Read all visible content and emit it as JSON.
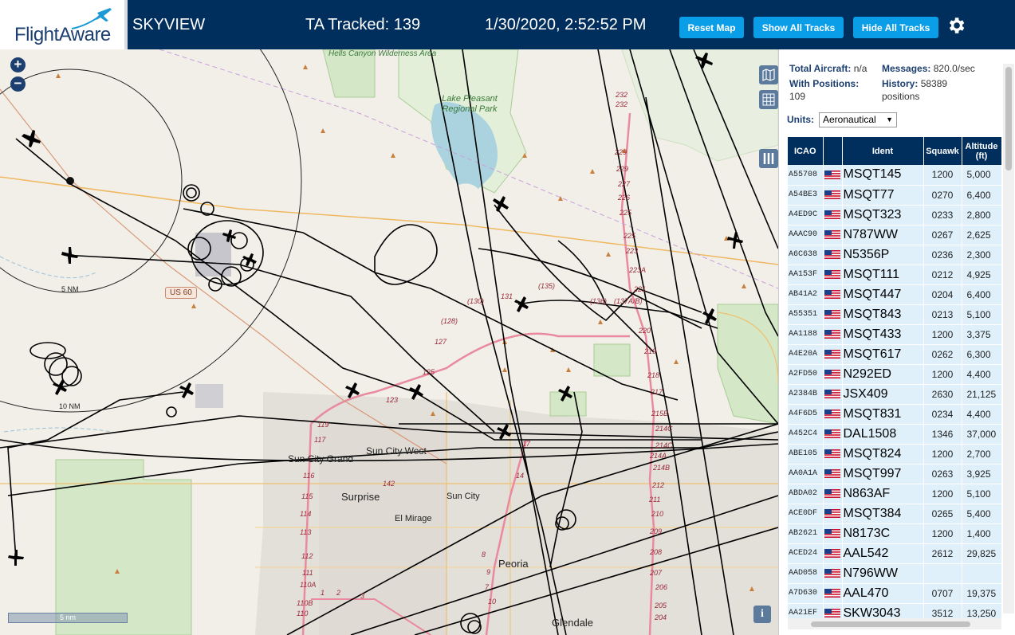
{
  "header": {
    "logo_text": "FlightAware",
    "site_name": "SKYVIEW",
    "ta_tracked": "TA Tracked: 139",
    "datetime": "1/30/2020, 2:52:52 PM",
    "buttons": {
      "reset_map": "Reset Map",
      "show_all_tracks": "Show All Tracks",
      "hide_all_tracks": "Hide All Tracks"
    },
    "settings_icon": "gear-icon",
    "colors": {
      "bar": "#002f5d",
      "button": "#0a9ee8"
    }
  },
  "map": {
    "zoom_in": "+",
    "zoom_out": "−",
    "range_labels": [
      "5 NM",
      "10 NM"
    ],
    "scale_label": "5 nm",
    "info_label": "i",
    "places": {
      "hells_canyon": "Hells Canyon Wilderness Area",
      "lake_pleasant": "Lake Pleasant Regional Park",
      "sun_city_grand": "Sun City Grand",
      "sun_city_west": "Sun City West",
      "surprise": "Surprise",
      "sun_city": "Sun City",
      "el_mirage": "El Mirage",
      "peoria": "Peoria",
      "glendale": "Glendale"
    },
    "route_shield": "US 60",
    "road_numbers_left": [
      "119",
      "117",
      "116",
      "115",
      "114",
      "113",
      "112",
      "111",
      "110A",
      "110B",
      "110",
      "1",
      "2",
      "3"
    ],
    "road_numbers_center": [
      "(130)",
      "131",
      "(135)",
      "(128)",
      "127",
      "125",
      "123",
      "142",
      "17",
      "14",
      "9",
      "8",
      "7",
      "10"
    ],
    "road_numbers_right": [
      "232",
      "232",
      "229",
      "229",
      "227",
      "226",
      "225",
      "225",
      "223",
      "223A",
      "221",
      "220",
      "219",
      "218",
      "217",
      "215B",
      "214C",
      "214C",
      "214A",
      "214B",
      "212",
      "211",
      "210",
      "209",
      "208",
      "207",
      "206",
      "205",
      "204",
      "(136)",
      "(137A/B)"
    ]
  },
  "sidebar": {
    "total_aircraft_label": "Total Aircraft:",
    "total_aircraft_value": "n/a",
    "messages_label": "Messages:",
    "messages_value": "820.0/sec",
    "with_positions_label": "With Positions:",
    "with_positions_value": "109",
    "history_label": "History:",
    "history_value": "58389",
    "history_unit": "positions",
    "units_label": "Units:",
    "units_value": "Aeronautical",
    "table": {
      "headers": [
        "ICAO",
        "",
        "Ident",
        "Squawk",
        "Altitude (ft)"
      ],
      "rows": [
        {
          "icao": "A55708",
          "ident": "MSQT145",
          "squawk": "1200",
          "alt": "5,000"
        },
        {
          "icao": "A54BE3",
          "ident": "MSQT77",
          "squawk": "0270",
          "alt": "6,400"
        },
        {
          "icao": "A4ED9C",
          "ident": "MSQT323",
          "squawk": "0233",
          "alt": "2,800"
        },
        {
          "icao": "AAAC90",
          "ident": "N787WW",
          "squawk": "0267",
          "alt": "2,625"
        },
        {
          "icao": "A6C638",
          "ident": "N5356P",
          "squawk": "0236",
          "alt": "2,300"
        },
        {
          "icao": "AA153F",
          "ident": "MSQT111",
          "squawk": "0212",
          "alt": "4,925"
        },
        {
          "icao": "AB41A2",
          "ident": "MSQT447",
          "squawk": "0204",
          "alt": "6,400"
        },
        {
          "icao": "A55351",
          "ident": "MSQT843",
          "squawk": "0213",
          "alt": "5,100"
        },
        {
          "icao": "AA1188",
          "ident": "MSQT433",
          "squawk": "1200",
          "alt": "3,375"
        },
        {
          "icao": "A4E20A",
          "ident": "MSQT617",
          "squawk": "0262",
          "alt": "6,300"
        },
        {
          "icao": "A2FD50",
          "ident": "N292ED",
          "squawk": "1200",
          "alt": "4,400"
        },
        {
          "icao": "A2384B",
          "ident": "JSX409",
          "squawk": "2630",
          "alt": "21,125"
        },
        {
          "icao": "A4F6D5",
          "ident": "MSQT831",
          "squawk": "0234",
          "alt": "4,400"
        },
        {
          "icao": "A452C4",
          "ident": "DAL1508",
          "squawk": "1346",
          "alt": "37,000"
        },
        {
          "icao": "ABE105",
          "ident": "MSQT824",
          "squawk": "1200",
          "alt": "2,700"
        },
        {
          "icao": "AA0A1A",
          "ident": "MSQT997",
          "squawk": "0263",
          "alt": "3,925"
        },
        {
          "icao": "ABDA02",
          "ident": "N863AF",
          "squawk": "1200",
          "alt": "5,100"
        },
        {
          "icao": "ACE0DF",
          "ident": "MSQT384",
          "squawk": "0265",
          "alt": "5,400"
        },
        {
          "icao": "AB2621",
          "ident": "N8173C",
          "squawk": "1200",
          "alt": "1,400"
        },
        {
          "icao": "ACED24",
          "ident": "AAL542",
          "squawk": "2612",
          "alt": "29,825"
        },
        {
          "icao": "AAD058",
          "ident": "N796WW",
          "squawk": "",
          "alt": ""
        },
        {
          "icao": "A7D630",
          "ident": "AAL470",
          "squawk": "0707",
          "alt": "19,375"
        },
        {
          "icao": "AA21EF",
          "ident": "SKW3043",
          "squawk": "3512",
          "alt": "13,250"
        }
      ]
    }
  }
}
